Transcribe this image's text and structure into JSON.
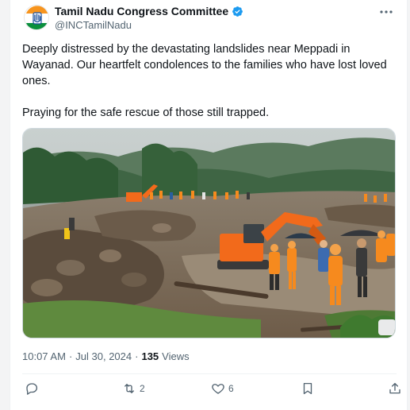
{
  "account": {
    "name": "Tamil Nadu Congress Committee",
    "handle": "@INCTamilNadu"
  },
  "tweet": {
    "paragraph1": "Deeply distressed by the devastating landslides near Meppadi in Wayanad. Our heartfelt condolences to the families who have lost loved ones.",
    "paragraph2": "Praying for the safe rescue of those still trapped."
  },
  "meta": {
    "time": "10:07 AM",
    "separator": "·",
    "date": "Jul 30, 2024",
    "views_count": "135",
    "views_label": "Views"
  },
  "actions": {
    "reply_count": "",
    "retweet_count": "2",
    "like_count": "6"
  },
  "icons": {
    "more": "more-icon",
    "verified": "verified-badge-icon",
    "reply": "reply-icon",
    "retweet": "retweet-icon",
    "like": "like-icon",
    "bookmark": "bookmark-icon",
    "share": "share-icon"
  },
  "colors": {
    "verified": "#1d9bf0",
    "text": "#0f1419",
    "secondary": "#536471",
    "excavator": "#f26a1b",
    "rescuer": "#f68a1e"
  }
}
